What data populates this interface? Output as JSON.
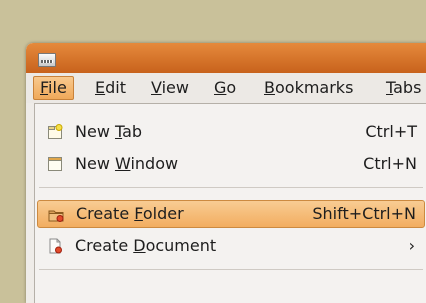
{
  "menubar": {
    "items": [
      {
        "pre": "",
        "u": "F",
        "post": "ile"
      },
      {
        "pre": "",
        "u": "E",
        "post": "dit"
      },
      {
        "pre": "",
        "u": "V",
        "post": "iew"
      },
      {
        "pre": "",
        "u": "G",
        "post": "o"
      },
      {
        "pre": "",
        "u": "B",
        "post": "ookmarks"
      },
      {
        "pre": "",
        "u": "T",
        "post": "abs"
      }
    ]
  },
  "file_menu": {
    "new_tab": {
      "pre": "New ",
      "u": "T",
      "post": "ab",
      "accel": "Ctrl+T",
      "icon": "new-tab-icon"
    },
    "new_window": {
      "pre": "New ",
      "u": "W",
      "post": "indow",
      "accel": "Ctrl+N",
      "icon": "new-window-icon"
    },
    "create_folder": {
      "pre": "Create ",
      "u": "F",
      "post": "older",
      "accel": "Shift+Ctrl+N",
      "icon": "folder-icon"
    },
    "create_document": {
      "pre": "Create ",
      "u": "D",
      "post": "ocument",
      "arrow": "›",
      "icon": "document-icon"
    }
  }
}
